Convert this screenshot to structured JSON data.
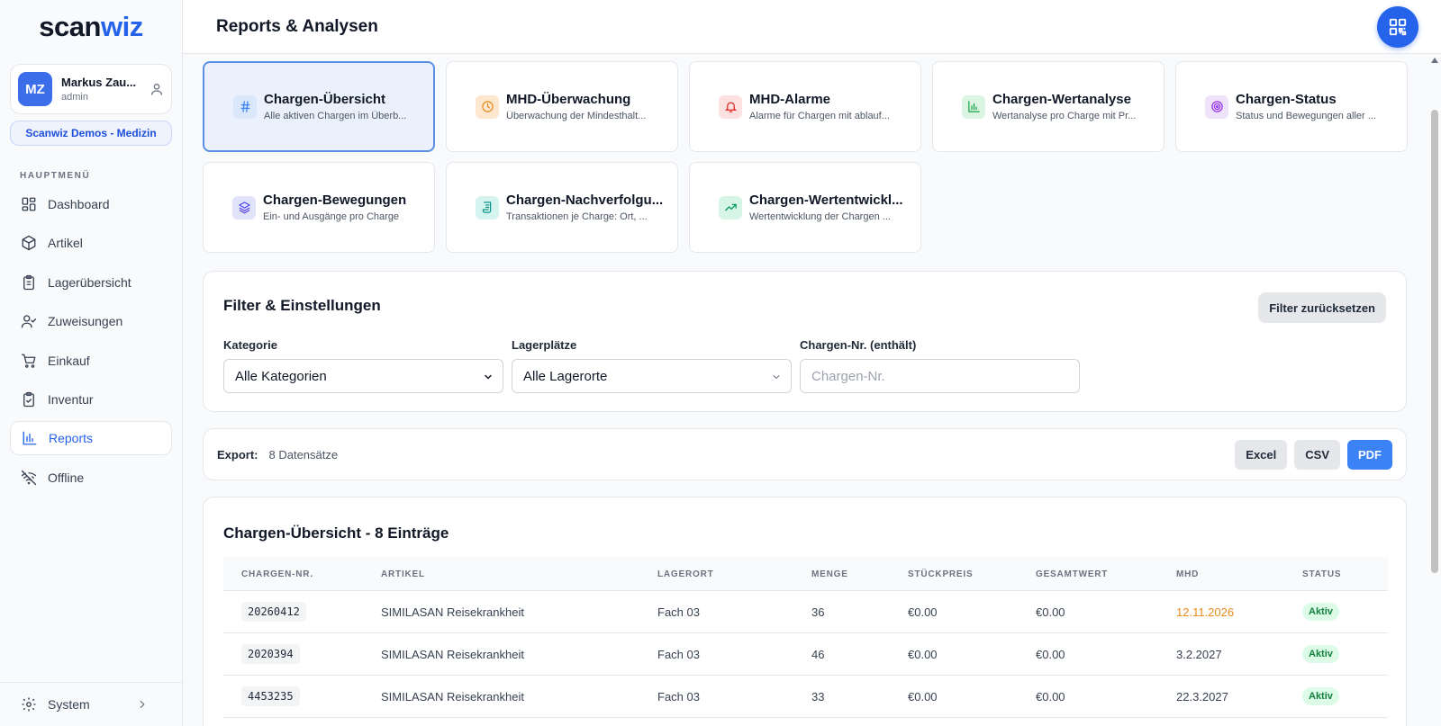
{
  "app": {
    "logo_main": "scan",
    "logo_accent": "wiz"
  },
  "user": {
    "initials": "MZ",
    "name": "Markus Zau...",
    "role": "admin"
  },
  "tenant": "Scanwiz Demos - Medizin",
  "sidebar": {
    "section_label": "HAUPTMENÜ",
    "items": [
      {
        "label": "Dashboard",
        "icon": "dashboard-icon"
      },
      {
        "label": "Artikel",
        "icon": "box-icon"
      },
      {
        "label": "Lagerübersicht",
        "icon": "clipboard-icon"
      },
      {
        "label": "Zuweisungen",
        "icon": "user-check-icon"
      },
      {
        "label": "Einkauf",
        "icon": "cart-icon"
      },
      {
        "label": "Inventur",
        "icon": "clipboard-check-icon"
      },
      {
        "label": "Reports",
        "icon": "bar-chart-icon",
        "active": true
      },
      {
        "label": "Offline",
        "icon": "wifi-off-icon"
      }
    ],
    "system_label": "System"
  },
  "header": {
    "title": "Reports & Analysen"
  },
  "reports": [
    {
      "title": "Chargen-Übersicht",
      "desc": "Alle aktiven Chargen im Überb...",
      "icon": "hash-icon",
      "color": "#3b82f6",
      "bg": "#dbe7fb",
      "active": true
    },
    {
      "title": "MHD-Überwachung",
      "desc": "Überwachung der Mindesthalt...",
      "icon": "clock-icon",
      "color": "#ea8a1e",
      "bg": "#fde7cf"
    },
    {
      "title": "MHD-Alarme",
      "desc": "Alarme für Chargen mit ablauf...",
      "icon": "bell-icon",
      "color": "#dc2626",
      "bg": "#fde0e0"
    },
    {
      "title": "Chargen-Wertanalyse",
      "desc": "Wertanalyse pro Charge mit Pr...",
      "icon": "bar-chart-icon",
      "color": "#16a34a",
      "bg": "#dcf5e3"
    },
    {
      "title": "Chargen-Status",
      "desc": "Status und Bewegungen aller ...",
      "icon": "target-icon",
      "color": "#9333ea",
      "bg": "#efe2fb"
    },
    {
      "title": "Chargen-Bewegungen",
      "desc": "Ein- und Ausgänge pro Charge",
      "icon": "layers-icon",
      "color": "#4f46e5",
      "bg": "#e0e3fa"
    },
    {
      "title": "Chargen-Nachverfolgu...",
      "desc": "Transaktionen je Charge: Ort, ...",
      "icon": "scroll-icon",
      "color": "#0d9488",
      "bg": "#d5f4ef"
    },
    {
      "title": "Chargen-Wertentwickl...",
      "desc": "Wertentwicklung der Chargen ...",
      "icon": "trending-up-icon",
      "color": "#059669",
      "bg": "#d6f5e6"
    }
  ],
  "filters": {
    "title": "Filter & Einstellungen",
    "reset_label": "Filter zurücksetzen",
    "category_label": "Kategorie",
    "category_value": "Alle Kategorien",
    "storage_label": "Lagerplätze",
    "storage_value": "Alle Lagerorte",
    "batch_label": "Chargen-Nr. (enthält)",
    "batch_placeholder": "Chargen-Nr."
  },
  "export": {
    "label": "Export:",
    "count": "8 Datensätze",
    "excel": "Excel",
    "csv": "CSV",
    "pdf": "PDF"
  },
  "table": {
    "title": "Chargen-Übersicht - 8 Einträge",
    "columns": [
      "CHARGEN-NR.",
      "ARTIKEL",
      "LAGERORT",
      "MENGE",
      "STÜCKPREIS",
      "GESAMTWERT",
      "MHD",
      "STATUS"
    ],
    "rows": [
      {
        "batch": "20260412",
        "article": "SIMILASAN Reisekrankheit",
        "location": "Fach 03",
        "qty": "36",
        "unit_price": "€0.00",
        "total": "€0.00",
        "mhd": "12.11.2026",
        "mhd_color": "#ea8a1e",
        "status": "Aktiv"
      },
      {
        "batch": "2020394",
        "article": "SIMILASAN Reisekrankheit",
        "location": "Fach 03",
        "qty": "46",
        "unit_price": "€0.00",
        "total": "€0.00",
        "mhd": "3.2.2027",
        "mhd_color": "#374151",
        "status": "Aktiv"
      },
      {
        "batch": "4453235",
        "article": "SIMILASAN Reisekrankheit",
        "location": "Fach 03",
        "qty": "33",
        "unit_price": "€0.00",
        "total": "€0.00",
        "mhd": "22.3.2027",
        "mhd_color": "#374151",
        "status": "Aktiv"
      }
    ]
  }
}
